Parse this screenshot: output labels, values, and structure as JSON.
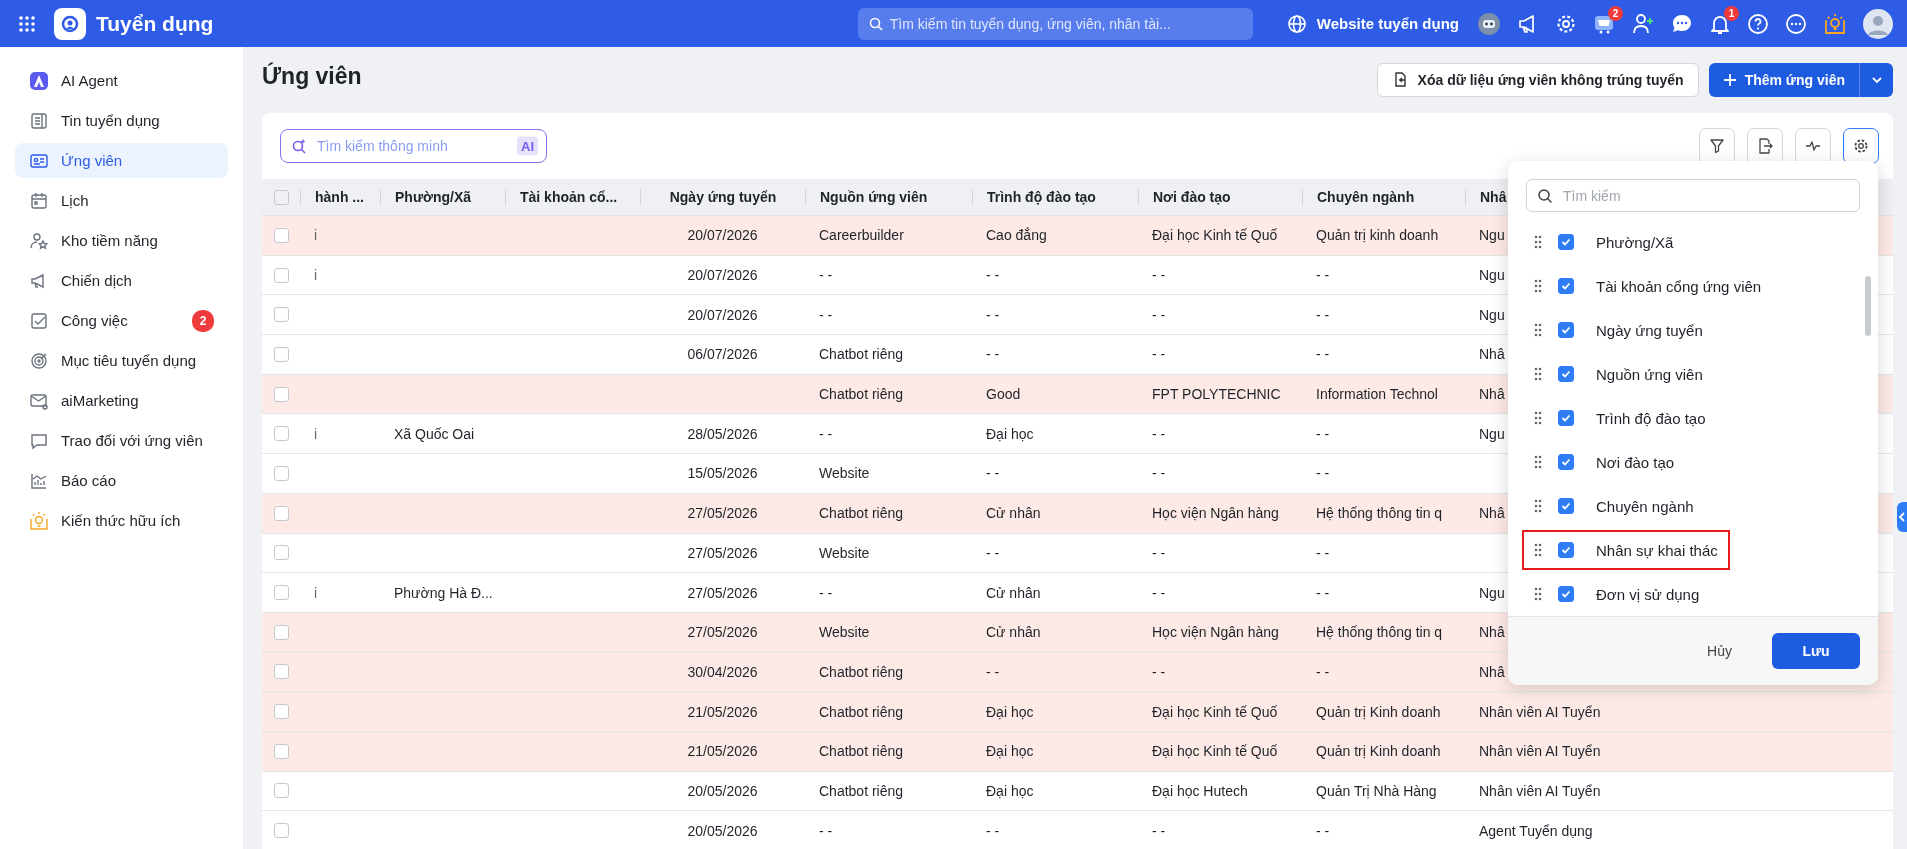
{
  "topbar": {
    "app_title": "Tuyển dụng",
    "search_placeholder": "Tìm kiếm tin tuyển dụng, ứng viên, nhân tài...",
    "website_link": "Website tuyển dụng",
    "icons": [
      {
        "kind": "robot"
      },
      {
        "kind": "megaphone"
      },
      {
        "kind": "gear"
      },
      {
        "kind": "cart",
        "badge": "2"
      },
      {
        "kind": "person-add"
      },
      {
        "kind": "chat"
      },
      {
        "kind": "bell",
        "badge": "1"
      },
      {
        "kind": "help"
      },
      {
        "kind": "more"
      },
      {
        "kind": "bulb"
      },
      {
        "kind": "avatar"
      }
    ]
  },
  "sidebar": {
    "items": [
      {
        "label": "AI Agent",
        "selected": false
      },
      {
        "label": "Tin tuyển dụng",
        "selected": false
      },
      {
        "label": "Ứng viên",
        "selected": true
      },
      {
        "label": "Lịch",
        "selected": false
      },
      {
        "label": "Kho tiềm năng",
        "selected": false
      },
      {
        "label": "Chiến dịch",
        "selected": false
      },
      {
        "label": "Công việc",
        "selected": false,
        "badge": "2"
      },
      {
        "label": "Mục tiêu tuyển dụng",
        "selected": false
      },
      {
        "label": "aiMarketing",
        "selected": false
      },
      {
        "label": "Trao đổi với ứng viên",
        "selected": false
      },
      {
        "label": "Báo cáo",
        "selected": false
      },
      {
        "label": "Kiến thức hữu ích",
        "selected": false
      }
    ]
  },
  "page": {
    "title": "Ứng viên",
    "clear_button": "Xóa dữ liệu ứng viên không trúng tuyển",
    "add_button": "Thêm ứng viên"
  },
  "smart_search": {
    "placeholder": "Tìm kiếm thông minh",
    "badge": "AI"
  },
  "toolbar": [
    {
      "kind": "filter",
      "active": false
    },
    {
      "kind": "export",
      "active": false
    },
    {
      "kind": "activity",
      "active": false
    },
    {
      "kind": "settings",
      "active": true
    }
  ],
  "table": {
    "select_all_checked": false,
    "columns": [
      "hành ...",
      "Phường/Xã",
      "Tài khoản cổ...",
      "Ngày ứng tuyển",
      "Nguồn ứng viên",
      "Trình độ đào tạo",
      "Nơi đào tạo",
      "Chuyên ngành",
      "Nhâ"
    ],
    "rows": [
      {
        "highlighted": true,
        "checked": false,
        "cells": [
          "i",
          null,
          null,
          "20/07/2026",
          "Careerbuilder",
          "Cao đẳng",
          "Đại học Kinh tế Quố",
          "Quản trị kinh doanh",
          "Ngu"
        ]
      },
      {
        "highlighted": false,
        "checked": false,
        "cells": [
          "i",
          null,
          null,
          "20/07/2026",
          "- -",
          "- -",
          "- -",
          "- -",
          "Ngu"
        ]
      },
      {
        "highlighted": false,
        "checked": false,
        "cells": [
          null,
          null,
          null,
          "20/07/2026",
          "- -",
          "- -",
          "- -",
          "- -",
          "Ngu"
        ]
      },
      {
        "highlighted": false,
        "checked": false,
        "cells": [
          null,
          null,
          null,
          "06/07/2026",
          "Chatbot riêng",
          "- -",
          "- -",
          "- -",
          "Nhâ"
        ]
      },
      {
        "highlighted": true,
        "checked": false,
        "cells": [
          null,
          null,
          null,
          null,
          "Chatbot riêng",
          "Good",
          "FPT POLYTECHNIC",
          "Information Technol",
          "Nhâ"
        ]
      },
      {
        "highlighted": false,
        "checked": false,
        "cells": [
          "i",
          "Xã Quốc Oai",
          null,
          "28/05/2026",
          "- -",
          "Đại học",
          "- -",
          "- -",
          "Ngu"
        ]
      },
      {
        "highlighted": false,
        "checked": false,
        "cells": [
          null,
          null,
          null,
          "15/05/2026",
          "Website",
          "- -",
          "- -",
          "- -",
          null
        ]
      },
      {
        "highlighted": true,
        "checked": false,
        "cells": [
          null,
          null,
          null,
          "27/05/2026",
          "Chatbot riêng",
          "Cử nhân",
          "Học viện Ngân hàng",
          "Hệ thống thông tin q",
          "Nhâ"
        ]
      },
      {
        "highlighted": false,
        "checked": false,
        "cells": [
          null,
          null,
          null,
          "27/05/2026",
          "Website",
          "- -",
          "- -",
          "- -",
          null
        ]
      },
      {
        "highlighted": false,
        "checked": false,
        "cells": [
          "i",
          "Phường Hà Đ...",
          null,
          "27/05/2026",
          "- -",
          "Cử nhân",
          "- -",
          "- -",
          "Ngu"
        ]
      },
      {
        "highlighted": true,
        "checked": false,
        "cells": [
          null,
          null,
          null,
          "27/05/2026",
          "Website",
          "Cử nhân",
          "Học viện Ngân hàng",
          "Hệ thống thông tin q",
          "Nhâ"
        ]
      },
      {
        "highlighted": true,
        "checked": false,
        "cells": [
          null,
          null,
          null,
          "30/04/2026",
          "Chatbot riêng",
          "- -",
          "- -",
          "- -",
          "Nhâ"
        ]
      },
      {
        "highlighted": true,
        "checked": false,
        "cells": [
          null,
          null,
          null,
          "21/05/2026",
          "Chatbot riêng",
          "Đại học",
          "Đại học Kinh tế Quố",
          "Quản trị Kinh doanh",
          "Nhân viên AI Tuyển"
        ]
      },
      {
        "highlighted": true,
        "checked": false,
        "cells": [
          null,
          null,
          null,
          "21/05/2026",
          "Chatbot riêng",
          "Đại học",
          "Đại học Kinh tế Quố",
          "Quản trị Kinh doanh",
          "Nhân viên AI Tuyển"
        ]
      },
      {
        "highlighted": false,
        "checked": false,
        "cells": [
          null,
          null,
          null,
          "20/05/2026",
          "Chatbot riêng",
          "Đại học",
          "Đại học Hutech",
          "Quản Trị Nhà Hàng",
          "Nhân viên AI Tuyển"
        ]
      },
      {
        "highlighted": false,
        "checked": false,
        "cells": [
          null,
          null,
          null,
          "20/05/2026",
          "- -",
          "- -",
          "- -",
          "- -",
          "Agent Tuyển dụng"
        ]
      }
    ]
  },
  "column_picker": {
    "search_placeholder": "Tìm kiếm",
    "items": [
      {
        "label": "Phường/Xã",
        "checked": true,
        "highlighted": false
      },
      {
        "label": "Tài khoản cổng ứng viên",
        "checked": true,
        "highlighted": false
      },
      {
        "label": "Ngày ứng tuyển",
        "checked": true,
        "highlighted": false
      },
      {
        "label": "Nguồn ứng viên",
        "checked": true,
        "highlighted": false
      },
      {
        "label": "Trình độ đào tạo",
        "checked": true,
        "highlighted": false
      },
      {
        "label": "Nơi đào tạo",
        "checked": true,
        "highlighted": false
      },
      {
        "label": "Chuyên ngành",
        "checked": true,
        "highlighted": false
      },
      {
        "label": "Nhân sự khai thác",
        "checked": true,
        "highlighted": true
      },
      {
        "label": "Đơn vị sử dụng",
        "checked": true,
        "highlighted": false
      }
    ],
    "cancel_button": "Hủy",
    "save_button": "Lưu"
  }
}
